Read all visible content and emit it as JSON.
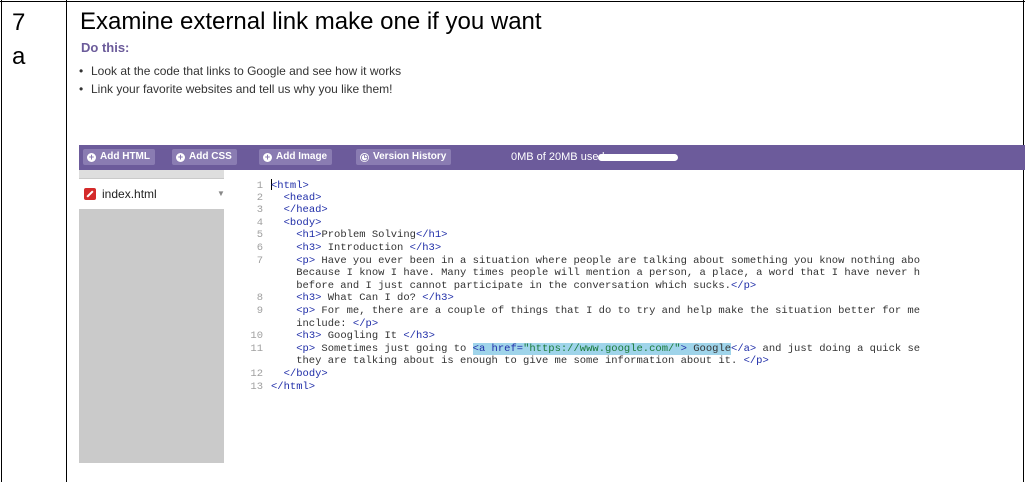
{
  "step": {
    "number": "7\na"
  },
  "title": "Examine external link make one if you want",
  "do_this": "Do this:",
  "bullets": [
    "Look at the code that links to Google and see how it works",
    "Link your favorite websites and tell us why you like them!"
  ],
  "toolbar": {
    "add_html": "Add HTML",
    "add_css": "Add CSS",
    "add_image": "Add Image",
    "version_history": "Version History",
    "usage": "0MB of 20MB used",
    "usage_fraction": 0.0
  },
  "sidebar": {
    "file_name": "index.html"
  },
  "code_lines": [
    {
      "n": "1",
      "text": "<html>"
    },
    {
      "n": "2",
      "text": "  <head>"
    },
    {
      "n": "3",
      "text": "  </head>"
    },
    {
      "n": "4",
      "text": "  <body>"
    },
    {
      "n": "5",
      "text": "    <h1>Problem Solving</h1>"
    },
    {
      "n": "6",
      "text": "    <h3> Introduction </h3>"
    },
    {
      "n": "7",
      "text": "    <p> Have you ever been in a situation where people are talking about something you know nothing abo"
    },
    {
      "n": "",
      "text": "    Because I know I have. Many times people will mention a person, a place, a word that I have never h"
    },
    {
      "n": "",
      "text": "    before and I just cannot participate in the conversation which sucks.</p>"
    },
    {
      "n": "8",
      "text": "    <h3> What Can I do? </h3>"
    },
    {
      "n": "9",
      "text": "    <p> For me, there are a couple of things that I do to try and help make the situation better for me"
    },
    {
      "n": "",
      "text": "    include: </p>"
    },
    {
      "n": "10",
      "text": "    <h3> Googling It </h3>"
    },
    {
      "n": "11",
      "text": "    <p> Sometimes just going to <a href=\"https://www.google.com/\"> Google</a> and just doing a quick se"
    },
    {
      "n": "",
      "text": "    they are talking about is enough to give me some information about it. </p>"
    },
    {
      "n": "12",
      "text": "  </body>"
    },
    {
      "n": "13",
      "text": "</html>"
    }
  ]
}
